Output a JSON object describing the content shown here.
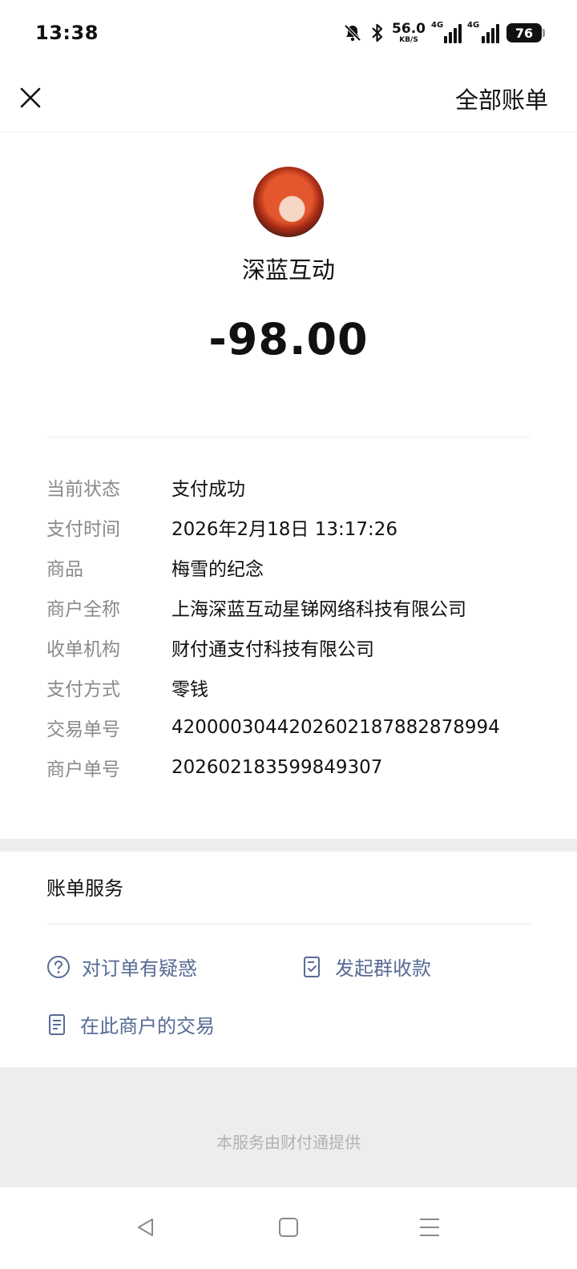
{
  "status_bar": {
    "time": "13:38",
    "net_speed_value": "56.0",
    "net_speed_unit": "KB/S",
    "network_1": "4G",
    "network_2": "4G",
    "battery": "76",
    "icons": [
      "mute-bell-icon",
      "bluetooth-icon",
      "signal-icon",
      "signal-icon"
    ]
  },
  "header": {
    "close_icon": "close-icon",
    "all_bills_label": "全部账单"
  },
  "summary": {
    "merchant": "深蓝互动",
    "amount": "-98.00"
  },
  "details": [
    {
      "label": "当前状态",
      "value": "支付成功"
    },
    {
      "label": "支付时间",
      "value": "2026年2月18日 13:17:26"
    },
    {
      "label": "商品",
      "value": "梅雪的纪念"
    },
    {
      "label": "商户全称",
      "value": "上海深蓝互动星锑网络科技有限公司"
    },
    {
      "label": "收单机构",
      "value": "财付通支付科技有限公司"
    },
    {
      "label": "支付方式",
      "value": "零钱"
    },
    {
      "label": "交易单号",
      "value": "4200003044202602187882878994"
    },
    {
      "label": "商户单号",
      "value": "202602183599849307"
    }
  ],
  "services": {
    "title": "账单服务",
    "items": [
      {
        "label": "对订单有疑惑",
        "icon": "question-circle-icon"
      },
      {
        "label": "发起群收款",
        "icon": "doc-check-icon"
      },
      {
        "label": "在此商户的交易",
        "icon": "doc-list-icon"
      }
    ]
  },
  "footer": {
    "provider_text": "本服务由财付通提供"
  },
  "colors": {
    "link": "#576b95",
    "label": "#8a8a8a",
    "band": "#ededed"
  }
}
